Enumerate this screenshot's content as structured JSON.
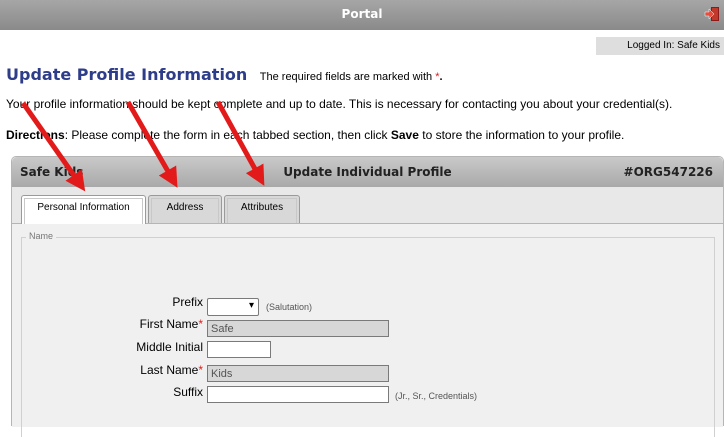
{
  "portal": {
    "title": "Portal",
    "exit_icon": "exit-icon"
  },
  "logged_in": "Logged In: Safe Kids",
  "heading": {
    "title": "Update Profile Information",
    "required_note": "The required fields are marked with",
    "required_star": "*",
    "required_dot": "."
  },
  "info_text": "Your profile information should be kept complete and up to date. This is necessary for contacting you about your credential(s).",
  "directions": {
    "label": "Directions",
    "text_before": ": Please complete the form in each tabbed section, then click ",
    "save_word": "Save",
    "text_after": " to store the information to your profile."
  },
  "panel": {
    "org_name": "Safe Kids",
    "title": "Update Individual Profile",
    "org_id": "#ORG547226"
  },
  "tabs": [
    {
      "label": "Personal Information",
      "active": true
    },
    {
      "label": "Address",
      "active": false
    },
    {
      "label": "Attributes",
      "active": false
    }
  ],
  "section": {
    "legend": "Name"
  },
  "fields": {
    "prefix": {
      "label": "Prefix",
      "value": "",
      "hint": "(Salutation)"
    },
    "first_name": {
      "label": "First Name",
      "required": "*",
      "value": "Safe"
    },
    "middle_initial": {
      "label": "Middle Initial",
      "value": ""
    },
    "last_name": {
      "label": "Last Name",
      "required": "*",
      "value": "Kids"
    },
    "suffix": {
      "label": "Suffix",
      "value": "",
      "hint": "(Jr., Sr., Credentials)"
    }
  },
  "colors": {
    "title": "#2e3d8a",
    "required": "#e01b1b",
    "arrow": "#e21a1a"
  }
}
